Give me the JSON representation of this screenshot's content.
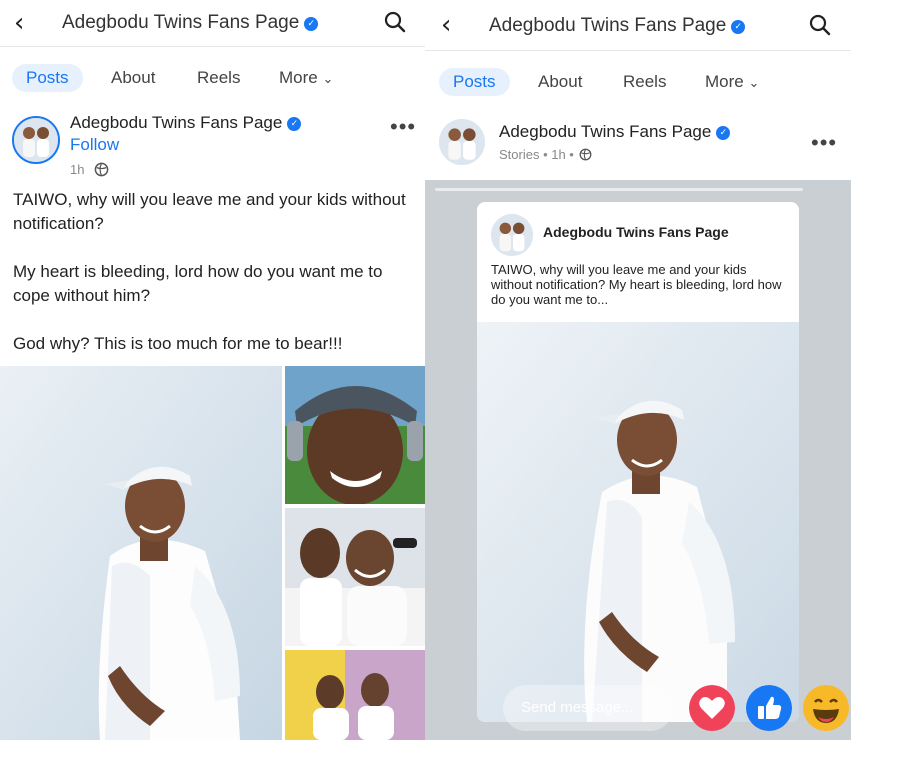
{
  "page_name": "Adegbodu Twins Fans Page",
  "left_screen": {
    "tabs": [
      "Posts",
      "About",
      "Reels",
      "More"
    ],
    "post": {
      "author": "Adegbodu Twins Fans Page",
      "follow_label": "Follow",
      "time": "1h",
      "caption": {
        "line1": "TAIWO, why will you leave me and your kids without notification?",
        "line2": "My heart is bleeding, lord how do you want me to cope without him?",
        "line3": "God why? This is too much for me to bear!!!"
      }
    }
  },
  "right_screen": {
    "tabs": [
      "Posts",
      "About",
      "Reels",
      "More"
    ],
    "post": {
      "author": "Adegbodu Twins Fans Page",
      "meta": "Stories • 1h •"
    },
    "story_card": {
      "author": "Adegbodu Twins Fans Page",
      "text": "TAIWO, why will you leave me and your kids without notification? My heart is bleeding, lord how do you want me to..."
    },
    "send_placeholder": "Send message..."
  },
  "icons": {
    "back": "chevron-left-icon",
    "search": "search-icon",
    "verified": "verified-badge-icon",
    "globe": "globe-icon",
    "more": "more-horizontal-icon",
    "love": "heart-reaction-icon",
    "like": "thumbs-up-reaction-icon",
    "haha": "laughing-face-reaction-icon"
  },
  "colors": {
    "accent": "#1877f2",
    "tab_active_bg": "#e7f0fd",
    "love": "#f0435a",
    "like": "#1877f2",
    "haha": "#f7b928"
  }
}
